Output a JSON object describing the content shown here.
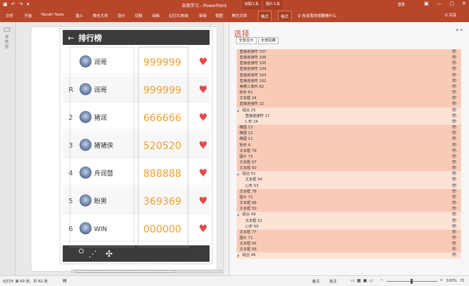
{
  "titlebar": {
    "title": "自我学习 - PowerPoint",
    "ctx_drawing": "绘图工具",
    "ctx_picture": "图片工具",
    "login": "登录",
    "min": "—",
    "max": "▢",
    "close": "✕"
  },
  "ribbon": {
    "tabs": [
      "文件",
      "开始",
      "Nordri Tools",
      "插入",
      "美化大师",
      "设计",
      "切换",
      "动画",
      "幻灯片放映",
      "审阅",
      "视图",
      "美化大师",
      "格式",
      "格式"
    ],
    "tellme": "♀ 告诉我你想要做什么",
    "share": "♀ 共享"
  },
  "slide": {
    "header_title": "排行榜",
    "rows": [
      {
        "rank": "",
        "name": "润哥",
        "score": "999999"
      },
      {
        "rank": "R",
        "name": "润哥",
        "score": "999999"
      },
      {
        "rank": "2",
        "name": "猪润",
        "score": "666666"
      },
      {
        "rank": "3",
        "name": "猪猪侠",
        "score": "520520"
      },
      {
        "rank": "4",
        "name": "舟润暨",
        "score": "888888"
      },
      {
        "rank": "5",
        "name": "盼男",
        "score": "369369"
      },
      {
        "rank": "6",
        "name": "WIN",
        "score": "000000"
      }
    ]
  },
  "pane": {
    "title": "选择",
    "show_all": "全部显示",
    "hide_all": "全部隐藏",
    "items": [
      {
        "label": "直接连接符 107",
        "level": 0,
        "type": "sel"
      },
      {
        "label": "直接连接符 106",
        "level": 0,
        "type": "sel"
      },
      {
        "label": "直接连接符 105",
        "level": 0,
        "type": "sel"
      },
      {
        "label": "直接连接符 104",
        "level": 0,
        "type": "sel"
      },
      {
        "label": "直接连接符 103",
        "level": 0,
        "type": "sel"
      },
      {
        "label": "直接连接符 102",
        "level": 0,
        "type": "sel"
      },
      {
        "label": "等腰三角形 82",
        "level": 0,
        "type": "sel"
      },
      {
        "label": "矩形 81",
        "level": 0,
        "type": "sel"
      },
      {
        "label": "文本框 24",
        "level": 0,
        "type": "sel"
      },
      {
        "label": "直接连接符 22",
        "level": 0,
        "type": "sel"
      },
      {
        "label": "组合 25",
        "level": 0,
        "type": "grp",
        "arrow": "◢"
      },
      {
        "label": "直接连接符 17",
        "level": 1,
        "type": "grp"
      },
      {
        "label": "L 形 14",
        "level": 1,
        "type": "grp"
      },
      {
        "label": "椭圆 13",
        "level": 0,
        "type": "sel"
      },
      {
        "label": "椭圆 12",
        "level": 0,
        "type": "sel"
      },
      {
        "label": "椭圆 11",
        "level": 0,
        "type": "sel"
      },
      {
        "label": "矩形 9",
        "level": 0,
        "type": "sel"
      },
      {
        "label": "文本框 79",
        "level": 0,
        "type": "sel"
      },
      {
        "label": "图片 73",
        "level": 0,
        "type": "sel"
      },
      {
        "label": "文本框 67",
        "level": 0,
        "type": "sel"
      },
      {
        "label": "文本框 60",
        "level": 0,
        "type": "sel"
      },
      {
        "label": "组合 52",
        "level": 0,
        "type": "grp",
        "arrow": "◢"
      },
      {
        "label": "文本框 54",
        "level": 1,
        "type": "grp"
      },
      {
        "label": "心形 53",
        "level": 1,
        "type": "grp"
      },
      {
        "label": "文本框 78",
        "level": 0,
        "type": "sel"
      },
      {
        "label": "图片 72",
        "level": 0,
        "type": "sel"
      },
      {
        "label": "文本框 66",
        "level": 0,
        "type": "sel"
      },
      {
        "label": "文本框 59",
        "level": 0,
        "type": "sel"
      },
      {
        "label": "组合 49",
        "level": 0,
        "type": "grp",
        "arrow": "◢"
      },
      {
        "label": "文本框 51",
        "level": 1,
        "type": "grp"
      },
      {
        "label": "心形 50",
        "level": 1,
        "type": "grp"
      },
      {
        "label": "文本框 77",
        "level": 0,
        "type": "sel"
      },
      {
        "label": "图片 71",
        "level": 0,
        "type": "sel"
      },
      {
        "label": "文本框 65",
        "level": 0,
        "type": "sel"
      },
      {
        "label": "文本框 58",
        "level": 0,
        "type": "sel"
      },
      {
        "label": "组合 46",
        "level": 0,
        "type": "grp",
        "arrow": "◢"
      }
    ]
  },
  "status": {
    "slide_info": "幻灯片 第 60 张，共 62 张",
    "notes": "备注",
    "comments": "批注",
    "zoom": "100%",
    "minus": "−",
    "plus": "+"
  },
  "colors": {
    "brand": "#b7472a",
    "score": "#f0a030",
    "selected_row": "#f9cbb7",
    "slide_bar": "#3b3b3b"
  }
}
